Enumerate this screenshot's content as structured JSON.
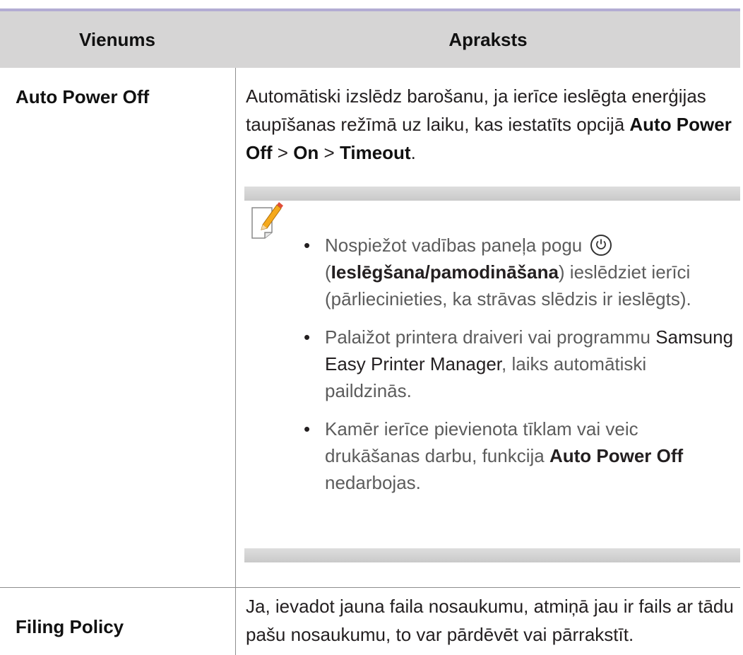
{
  "table": {
    "headers": {
      "item": "Vienums",
      "description": "Apraksts"
    },
    "rows": [
      {
        "item": "Auto Power Off",
        "description": {
          "t1": "Automātiski izslēdz barošanu, ja ierīce ieslēgta enerģijas taupīšanas režīmā uz laiku, kas iestatīts opcijā ",
          "b1": "Auto Power Off",
          "t2": " > ",
          "b2": "On",
          "t3": " > ",
          "b3": "Timeout",
          "t4": "."
        },
        "note": {
          "icon": "note-pencil-icon",
          "bullets": [
            {
              "t1": "Nospiežot vadības paneļa pogu ",
              "power_icon": "power-button-icon",
              "t2": " (",
              "b1": "Ieslēgšana/pamodināšana",
              "t3": ") ieslēdziet ierīci (pārliecinieties, ka strāvas slēdzis ir ieslēgts)."
            },
            {
              "t1": "Palaižot printera draiveri vai programmu ",
              "d1": "Samsung Easy Printer Manager",
              "t2": ", laiks automātiski paildzinās."
            },
            {
              "t1": "Kamēr ierīce pievienota tīklam vai veic drukāšanas darbu, funkcija ",
              "b1": "Auto Power Off",
              "t2": " nedarbojas."
            }
          ]
        }
      },
      {
        "item": "Filing Policy",
        "description": {
          "t1": "Ja, ievadot jauna faila nosaukumu, atmiņā jau ir fails ar tādu pašu nosaukumu, to var pārdēvēt vai pārrakstīt."
        }
      }
    ]
  }
}
